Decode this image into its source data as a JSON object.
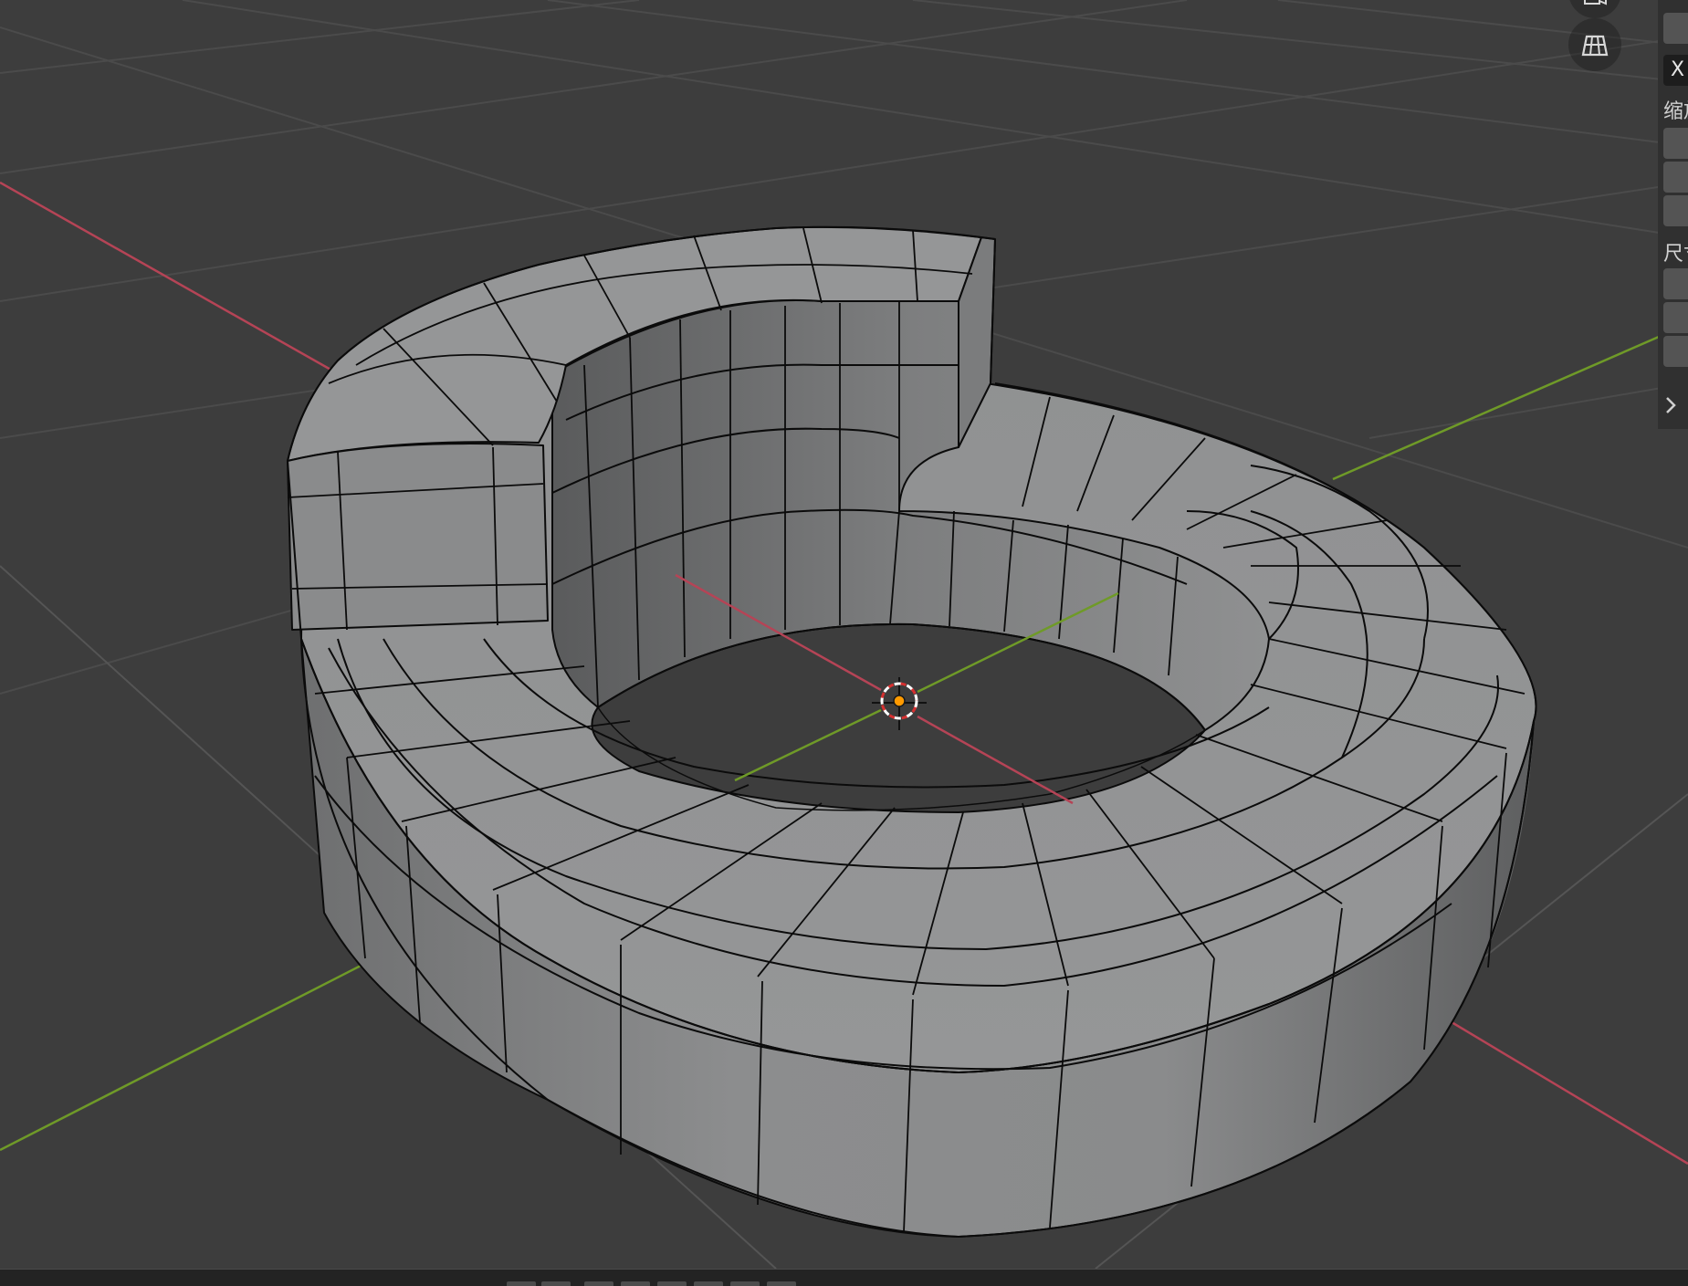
{
  "viewport": {
    "background": "#3d3d3d",
    "grid_color": "#4a4a4a",
    "x_axis_color": "#b54456",
    "y_axis_color": "#6f9a28",
    "mesh_color": "#8d8e8f",
    "wire_color": "#0a0a0a",
    "origin_color": "#ff9a00"
  },
  "nav_gizmo": {
    "buttons": [
      {
        "icon": "camera-icon"
      },
      {
        "icon": "perspective-grid-icon"
      }
    ]
  },
  "properties_panel": {
    "axis_x_label": "X",
    "scale_label": "缩放",
    "dimensions_label": "尺寸",
    "collapsed_icon": "chevron-right-icon"
  }
}
